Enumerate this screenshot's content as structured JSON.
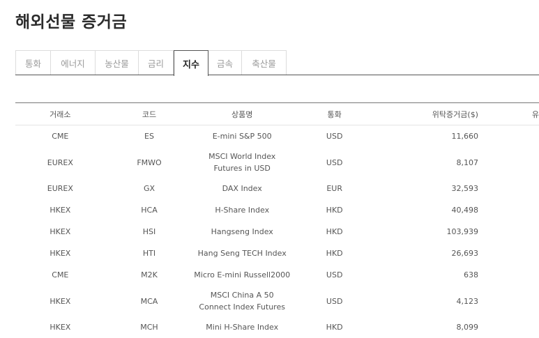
{
  "page_title": "해외선물 증거금",
  "tabs": [
    {
      "label": "통화",
      "active": false
    },
    {
      "label": "에너지",
      "active": false
    },
    {
      "label": "농산물",
      "active": false
    },
    {
      "label": "금리",
      "active": false
    },
    {
      "label": "지수",
      "active": true
    },
    {
      "label": "금속",
      "active": false
    },
    {
      "label": "축산물",
      "active": false
    }
  ],
  "table": {
    "headers": [
      "거래소",
      "코드",
      "상품명",
      "통화",
      "위탁증거금($)",
      "유"
    ],
    "rows": [
      {
        "exchange": "CME",
        "code": "ES",
        "name": [
          "E-mini S&P 500"
        ],
        "currency": "USD",
        "margin": "11,660"
      },
      {
        "exchange": "EUREX",
        "code": "FMWO",
        "name": [
          "MSCI World Index",
          "Futures in USD"
        ],
        "currency": "USD",
        "margin": "8,107"
      },
      {
        "exchange": "EUREX",
        "code": "GX",
        "name": [
          "DAX Index"
        ],
        "currency": "EUR",
        "margin": "32,593"
      },
      {
        "exchange": "HKEX",
        "code": "HCA",
        "name": [
          "H-Share Index"
        ],
        "currency": "HKD",
        "margin": "40,498"
      },
      {
        "exchange": "HKEX",
        "code": "HSI",
        "name": [
          "Hangseng Index"
        ],
        "currency": "HKD",
        "margin": "103,939"
      },
      {
        "exchange": "HKEX",
        "code": "HTI",
        "name": [
          "Hang Seng TECH Index"
        ],
        "currency": "HKD",
        "margin": "26,693"
      },
      {
        "exchange": "CME",
        "code": "M2K",
        "name": [
          "Micro E-mini Russell2000"
        ],
        "currency": "USD",
        "margin": "638"
      },
      {
        "exchange": "HKEX",
        "code": "MCA",
        "name": [
          "MSCI China A 50",
          "Connect Index Futures"
        ],
        "currency": "USD",
        "margin": "4,123"
      },
      {
        "exchange": "HKEX",
        "code": "MCH",
        "name": [
          "Mini H-Share Index"
        ],
        "currency": "HKD",
        "margin": "8,099"
      }
    ]
  }
}
